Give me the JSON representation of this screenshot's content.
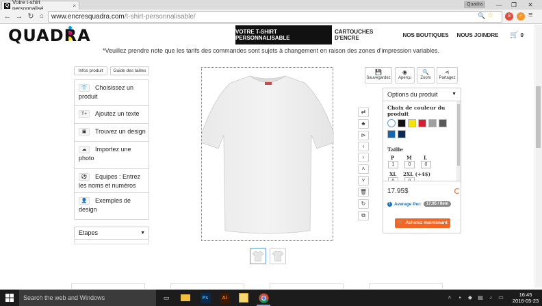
{
  "browser": {
    "tab_title": "Votre t-shirt personnalisé",
    "tab_close": "×",
    "favicon_letter": "Q",
    "user_name": "Quadra",
    "url_domain": "www.encresquadra.com",
    "url_path": "/t-shirt-personnalisable/",
    "win_min": "—",
    "win_max": "❐",
    "win_close": "✕"
  },
  "site": {
    "logo": "QUADRA",
    "nav": {
      "tshirt": "VOTRE T-SHIRT PERSONNALISABLE",
      "cartouches": "CARTOUCHES D'ENCRE",
      "boutiques": "NOS BOUTIQUES",
      "contact": "NOUS JOINDRE",
      "cart_count": "0"
    },
    "notice": "*Veuillez prendre note que les tarifs des commandes sont sujets à changement en raison des zones d'impression variables."
  },
  "left": {
    "infos_btn": "Infos produit",
    "guide_btn": "Guide des tailles",
    "items": [
      {
        "label": "Choisissez un produit",
        "icon": "tshirt-icon"
      },
      {
        "label": "Ajoutez un texte",
        "icon": "text-icon"
      },
      {
        "label": "Trouvez un design",
        "icon": "image-icon"
      },
      {
        "label": "Importez une photo",
        "icon": "upload-icon"
      },
      {
        "label": "Equipes : Entrez les noms et numéros",
        "icon": "team-icon"
      },
      {
        "label": "Exemples de design",
        "icon": "user-icon"
      }
    ],
    "etapes": "Etapes"
  },
  "toolbar_right": {
    "save": "Sauvegardez",
    "preview": "Aperçu",
    "zoom": "Zoom",
    "share": "Partagez"
  },
  "options": {
    "header": "Options du produit",
    "color_label": "Choix de couleur du produit",
    "colors": [
      "#ffffff",
      "#111111",
      "#f5e400",
      "#d32030",
      "#9e9e9e",
      "#5a5a5a",
      "#1565b0",
      "#0d2a55"
    ],
    "size_label": "Taille",
    "sizes": [
      {
        "label": "P",
        "qty": "1"
      },
      {
        "label": "M",
        "qty": "0"
      },
      {
        "label": "L",
        "qty": "0"
      },
      {
        "label": "XL",
        "qty": "0"
      },
      {
        "label": "2XL (+4$)",
        "qty": "0"
      }
    ],
    "price": "17.95$",
    "average_label": "Average Per:",
    "average_value": "17.95 / Item",
    "buy": "Achetez maintenant",
    "accent": "#f26522"
  },
  "taskbar": {
    "search_placeholder": "Search the web and Windows",
    "time": "16:45",
    "date": "2016-05-23"
  }
}
